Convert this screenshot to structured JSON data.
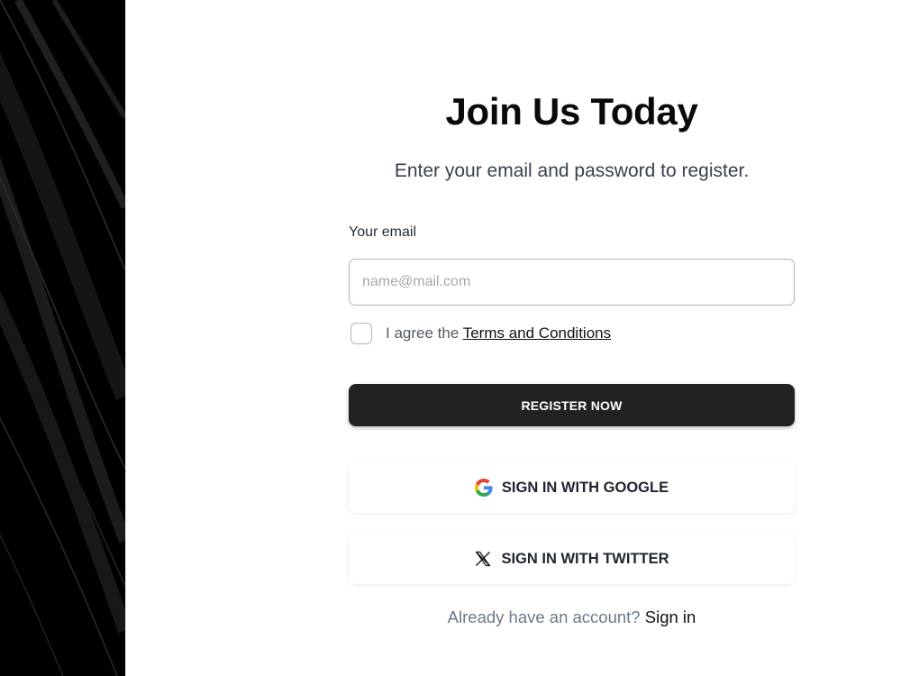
{
  "register": {
    "title": "Join Us Today",
    "subtitle": "Enter your email and password to register.",
    "email_label": "Your email",
    "email_placeholder": "name@mail.com",
    "email_value": "",
    "agree_prefix": "I agree the ",
    "terms_link": "Terms and Conditions",
    "terms_checked": false,
    "register_button": "REGISTER NOW",
    "google_button": "SIGN IN WITH GOOGLE",
    "twitter_button": "SIGN IN WITH TWITTER",
    "signin_prompt": "Already have an account?",
    "signin_link": "Sign in"
  },
  "icons": {
    "google": "google-icon",
    "twitter": "x-icon"
  },
  "colors": {
    "primary_button": "#222222",
    "side_panel": "#000000",
    "prompt_text": "#6a7a88"
  }
}
